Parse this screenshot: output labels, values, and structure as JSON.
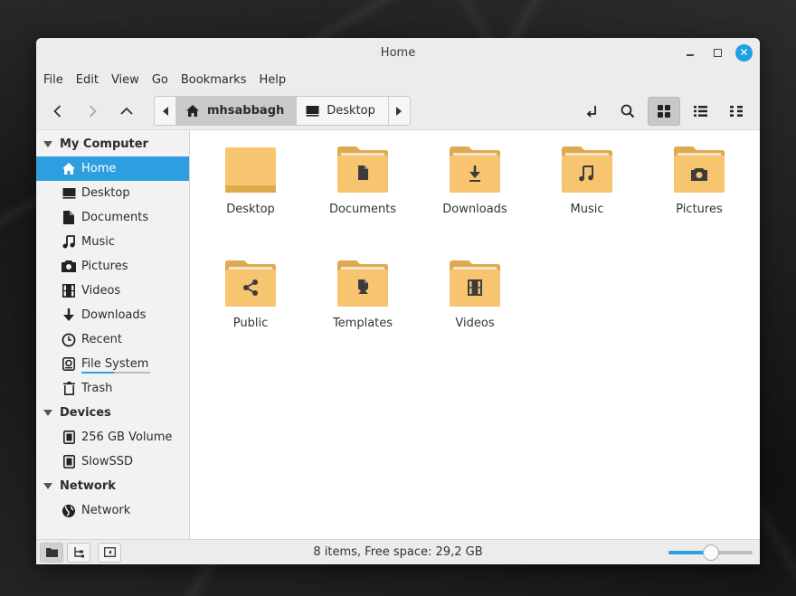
{
  "window": {
    "title": "Home"
  },
  "menubar": [
    "File",
    "Edit",
    "View",
    "Go",
    "Bookmarks",
    "Help"
  ],
  "pathbar": {
    "crumbs": [
      "mhsabbagh",
      "Desktop"
    ]
  },
  "sidebar": {
    "my_computer": {
      "header": "My Computer",
      "items": [
        "Home",
        "Desktop",
        "Documents",
        "Music",
        "Pictures",
        "Videos",
        "Downloads",
        "Recent",
        "File System",
        "Trash"
      ]
    },
    "devices": {
      "header": "Devices",
      "items": [
        "256 GB Volume",
        "SlowSSD"
      ]
    },
    "network": {
      "header": "Network",
      "items": [
        "Network"
      ]
    },
    "file_system_usage": 0.47
  },
  "files": [
    "Desktop",
    "Documents",
    "Downloads",
    "Music",
    "Pictures",
    "Public",
    "Templates",
    "Videos"
  ],
  "status": {
    "text": "8 items, Free space: 29,2 GB",
    "zoom_level": 0.5
  },
  "colors": {
    "accent": "#2d9ee0",
    "folder": "#f7c56f",
    "folder_dark": "#e0a94e",
    "folder_glyph": "#3c3c3c"
  }
}
